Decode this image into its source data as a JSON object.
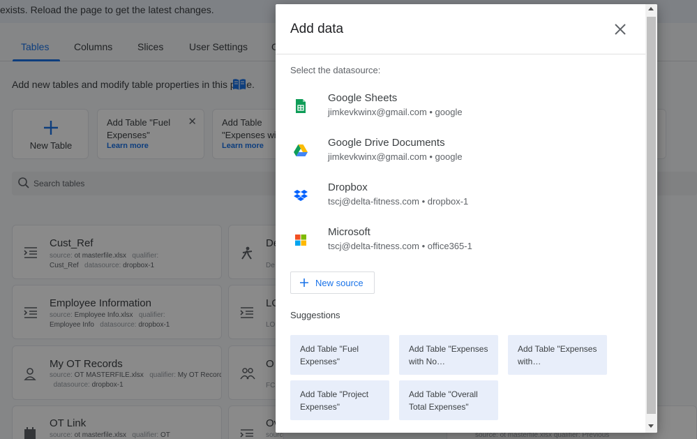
{
  "banner": {
    "text": "exists. Reload the page to get the latest changes."
  },
  "tabs": [
    {
      "label": "Tables",
      "active": true
    },
    {
      "label": "Columns"
    },
    {
      "label": "Slices"
    },
    {
      "label": "User Settings"
    },
    {
      "label": "O"
    }
  ],
  "pane": {
    "description": "Add new tables and modify table properties in this pane.",
    "new_table_label": "New Table",
    "suggestions": [
      {
        "title": "Add Table \"Fuel Expenses\"",
        "link": "Learn more"
      },
      {
        "title": "Add Table \"Expenses wi",
        "link": "Learn more"
      }
    ],
    "search_placeholder": "Search tables"
  },
  "tables": [
    {
      "name": "Cust_Ref",
      "source": "ot masterfile.xlsx",
      "qualifier": "Cust_Ref",
      "datasource": "dropbox-1",
      "icon": "table-icon"
    },
    {
      "name": "Employee Information",
      "source": "Employee Info.xlsx",
      "qualifier": "Employee Info",
      "datasource": "dropbox-1",
      "icon": "table-icon"
    },
    {
      "name": "My OT Records",
      "source": "OT MASTERFILE.xlsx",
      "qualifier": "My OT Records",
      "datasource": "dropbox-1",
      "icon": "person-badge-icon"
    },
    {
      "name": "OT Link",
      "source": "ot masterfile.xlsx",
      "qualifier": "OT",
      "icon": "calendar-icon"
    }
  ],
  "tables_right": [
    {
      "name": "De",
      "meta": "De",
      "icon": "person-walk-icon"
    },
    {
      "name": "LO",
      "meta": "LO",
      "icon": "table-icon"
    },
    {
      "name": "O",
      "meta": "FC",
      "icon": "people-icon"
    },
    {
      "name": "Ov",
      "meta": "source: overall summary",
      "icon": "table-icon"
    }
  ],
  "labels": {
    "source": "source:",
    "qualifier": "qualifier:",
    "datasource": "datasource:"
  },
  "bottom_right_text": "source: ot masterfile.xlsx   qualifier: Previous",
  "dialog": {
    "title": "Add data",
    "subtitle": "Select the datasource:",
    "sources": [
      {
        "name": "Google Sheets",
        "account": "jimkevkwinx@gmail.com • google",
        "icon": "google-sheets-icon"
      },
      {
        "name": "Google Drive Documents",
        "account": "jimkevkwinx@gmail.com • google",
        "icon": "google-drive-icon"
      },
      {
        "name": "Dropbox",
        "account": "tscj@delta-fitness.com • dropbox-1",
        "icon": "dropbox-icon"
      },
      {
        "name": "Microsoft",
        "account": "tscj@delta-fitness.com • office365-1",
        "icon": "microsoft-icon"
      }
    ],
    "new_source_label": "New source",
    "suggestions_heading": "Suggestions",
    "suggestions": [
      "Add Table \"Fuel Expenses\"",
      "Add Table \"Expenses with No…",
      "Add Table \"Expenses with…",
      "Add Table \"Project Expenses\"",
      "Add Table \"Overall Total Expenses\""
    ]
  },
  "colors": {
    "accent": "#1a73e8",
    "chip_bg": "#e8eefa",
    "sheets_green": "#0f9d58",
    "dropbox_blue": "#0061fe"
  }
}
